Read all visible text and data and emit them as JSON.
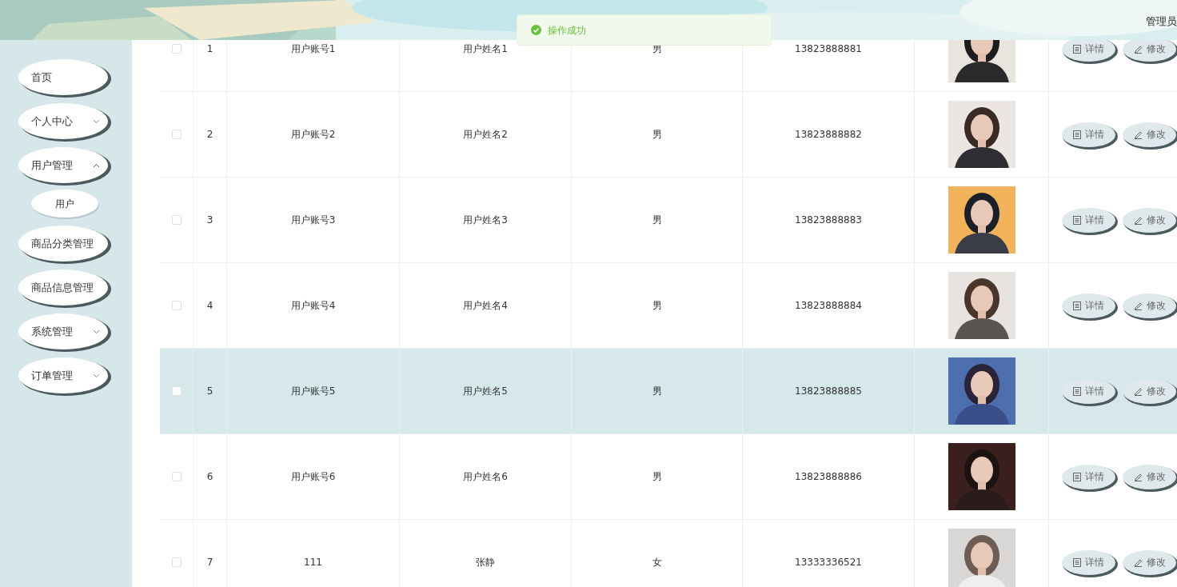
{
  "header": {
    "user": "管理员"
  },
  "toast": {
    "message": "操作成功"
  },
  "sidebar": {
    "items": [
      {
        "label": "首页",
        "kind": "link"
      },
      {
        "label": "个人中心",
        "kind": "submenu"
      },
      {
        "label": "用户管理",
        "kind": "submenu",
        "expanded": true,
        "children": [
          {
            "label": "用户"
          }
        ]
      },
      {
        "label": "商品分类管理",
        "kind": "link"
      },
      {
        "label": "商品信息管理",
        "kind": "link"
      },
      {
        "label": "系统管理",
        "kind": "submenu"
      },
      {
        "label": "订单管理",
        "kind": "submenu"
      }
    ]
  },
  "table": {
    "rows": [
      {
        "index": "1",
        "account": "用户账号1",
        "name": "用户姓名1",
        "gender": "男",
        "phone": "13823888881",
        "checked": false,
        "selected": false,
        "actions": [
          "详情",
          "修改"
        ]
      },
      {
        "index": "2",
        "account": "用户账号2",
        "name": "用户姓名2",
        "gender": "男",
        "phone": "13823888882",
        "checked": false,
        "selected": false,
        "actions": [
          "详情",
          "修改"
        ]
      },
      {
        "index": "3",
        "account": "用户账号3",
        "name": "用户姓名3",
        "gender": "男",
        "phone": "13823888883",
        "checked": false,
        "selected": false,
        "actions": [
          "详情",
          "修改"
        ]
      },
      {
        "index": "4",
        "account": "用户账号4",
        "name": "用户姓名4",
        "gender": "男",
        "phone": "13823888884",
        "checked": false,
        "selected": false,
        "actions": [
          "详情",
          "修改"
        ]
      },
      {
        "index": "5",
        "account": "用户账号5",
        "name": "用户姓名5",
        "gender": "男",
        "phone": "13823888885",
        "checked": false,
        "selected": true,
        "actions": [
          "详情",
          "修改"
        ]
      },
      {
        "index": "6",
        "account": "用户账号6",
        "name": "用户姓名6",
        "gender": "男",
        "phone": "13823888886",
        "checked": false,
        "selected": false,
        "actions": [
          "详情",
          "修改"
        ]
      },
      {
        "index": "7",
        "account": "111",
        "name": "张静",
        "gender": "女",
        "phone": "13333336521",
        "checked": false,
        "selected": false,
        "actions": [
          "详情",
          "修改"
        ]
      }
    ]
  }
}
